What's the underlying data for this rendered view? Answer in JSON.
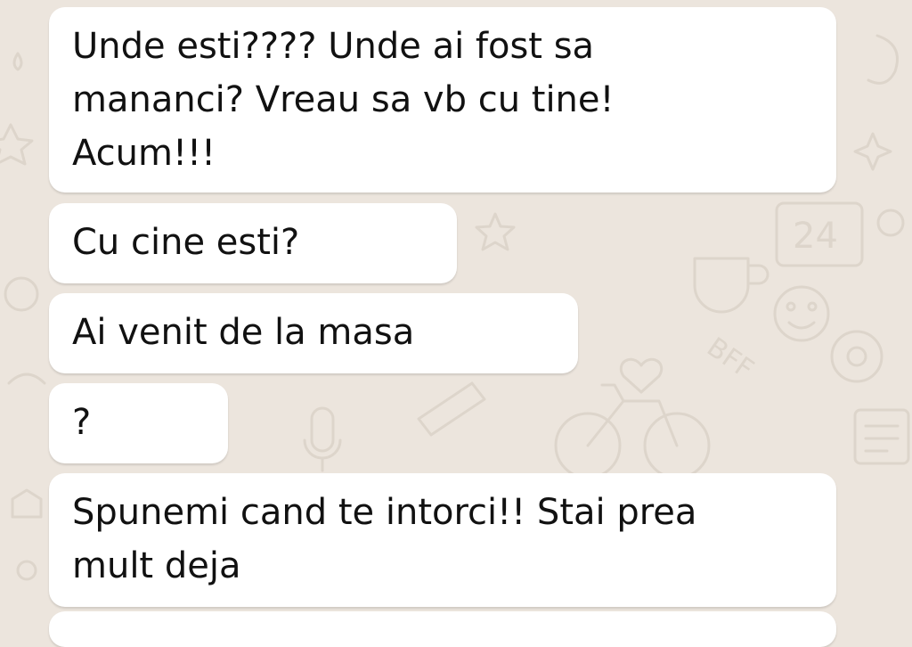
{
  "chat": {
    "messages": [
      {
        "text": "Unde esti???? Unde ai fost sa\nmananci? Vreau sa vb cu tine!\nAcum!!!"
      },
      {
        "text": "Cu cine esti?"
      },
      {
        "text": "Ai venit de la masa"
      },
      {
        "text": "?"
      },
      {
        "text": "Spunemi cand te intorci!! Stai prea\nmult deja"
      }
    ]
  },
  "theme": {
    "background": "#ece5dd",
    "bubble": "#ffffff",
    "text": "#111111"
  }
}
